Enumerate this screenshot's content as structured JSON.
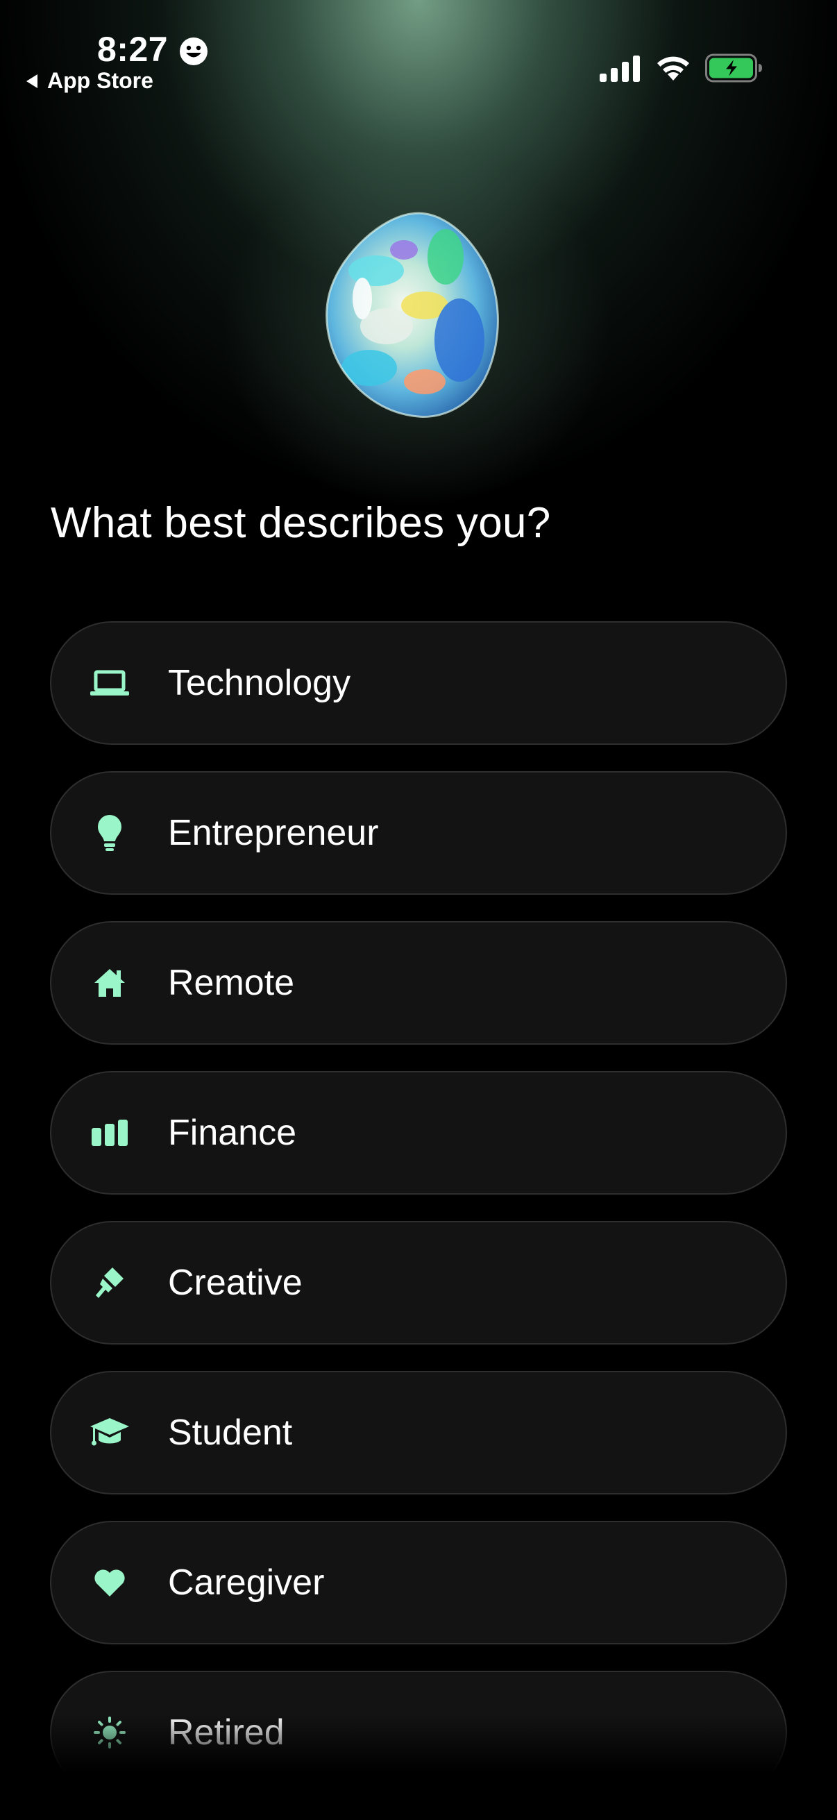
{
  "status_bar": {
    "time": "8:27",
    "back_label": "App Store"
  },
  "colors": {
    "accent": "#9af5c8",
    "option_bg": "#131313",
    "option_border": "#2e2e2e",
    "battery_green": "#34c759"
  },
  "onboarding": {
    "question": "What best describes you?",
    "options": [
      {
        "label": "Technology",
        "icon": "laptop-icon"
      },
      {
        "label": "Entrepreneur",
        "icon": "lightbulb-icon"
      },
      {
        "label": "Remote",
        "icon": "house-icon"
      },
      {
        "label": "Finance",
        "icon": "bar-chart-icon"
      },
      {
        "label": "Creative",
        "icon": "paintbrush-icon"
      },
      {
        "label": "Student",
        "icon": "graduation-cap-icon"
      },
      {
        "label": "Caregiver",
        "icon": "heart-icon"
      },
      {
        "label": "Retired",
        "icon": "sun-icon"
      }
    ]
  }
}
